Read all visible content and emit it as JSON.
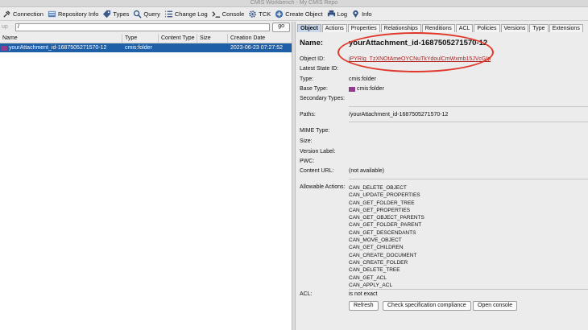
{
  "window": {
    "title": "CMIS Workbench - My CMIS Repo"
  },
  "toolbar": {
    "items": [
      {
        "label": "Connection",
        "icon": "connection-icon"
      },
      {
        "label": "Repository Info",
        "icon": "repository-info-icon"
      },
      {
        "label": "Types",
        "icon": "types-icon"
      },
      {
        "label": "Query",
        "icon": "search-icon"
      },
      {
        "label": "Change Log",
        "icon": "list-icon"
      },
      {
        "label": "Console",
        "icon": "console-icon"
      },
      {
        "label": "TCK",
        "icon": "gear-icon"
      },
      {
        "label": "Create Object",
        "icon": "plus-icon"
      },
      {
        "label": "Log",
        "icon": "printer-icon"
      },
      {
        "label": "Info",
        "icon": "pin-icon"
      }
    ]
  },
  "navigation": {
    "up_label": "up",
    "path_value": "/",
    "go_label": "go"
  },
  "table": {
    "columns": [
      "Name",
      "Type",
      "Content Type",
      "Size",
      "Creation Date"
    ],
    "rows": [
      {
        "name": "yourAttachment_id-1687505271570-12",
        "type": "cmis:folder",
        "content_type": "",
        "size": "",
        "creation_date": "2023-06-23 07:27:52"
      }
    ]
  },
  "tabs": [
    "Object",
    "Actions",
    "Properties",
    "Relationships",
    "Renditions",
    "ACL",
    "Policies",
    "Versions",
    "Type",
    "Extensions"
  ],
  "active_tab": "Object",
  "details": {
    "name_label": "Name:",
    "name_value": "yourAttachment_id-1687505271570-12",
    "object_id_label": "Object ID:",
    "object_id_value": "jPYRIg_TzXNOtAmeOYCNuTkYdoulCmWxmb15JVcGIp",
    "latest_state_label": "Latest State ID:",
    "type_label": "Type:",
    "type_value": "cmis:folder",
    "base_type_label": "Base Type:",
    "base_type_value": "cmis:folder",
    "secondary_types_label": "Secondary Types:",
    "paths_label": "Paths:",
    "paths_value": "/yourAttachment_id-1687505271570-12",
    "mime_label": "MIME Type:",
    "size_label": "Size:",
    "version_label": "Version Label:",
    "pwc_label": "PWC:",
    "content_url_label": "Content URL:",
    "content_url_value": "(not available)",
    "allowable_actions_label": "Allowable Actions:",
    "allowable_actions": [
      "CAN_DELETE_OBJECT",
      "CAN_UPDATE_PROPERTIES",
      "CAN_GET_FOLDER_TREE",
      "CAN_GET_PROPERTIES",
      "CAN_GET_OBJECT_PARENTS",
      "CAN_GET_FOLDER_PARENT",
      "CAN_GET_DESCENDANTS",
      "CAN_MOVE_OBJECT",
      "CAN_GET_CHILDREN",
      "CAN_CREATE_DOCUMENT",
      "CAN_CREATE_FOLDER",
      "CAN_DELETE_TREE",
      "CAN_GET_ACL",
      "CAN_APPLY_ACL"
    ],
    "acl_label": "ACL:",
    "acl_value": "is not exact"
  },
  "buttons": {
    "refresh": "Refresh",
    "check_compliance": "Check specification compliance",
    "open_console": "Open console"
  },
  "colors": {
    "selection": "#1e5fa8",
    "link": "#b01e1e",
    "annotation": "#e0392b",
    "folder": "#8e3d8a"
  }
}
